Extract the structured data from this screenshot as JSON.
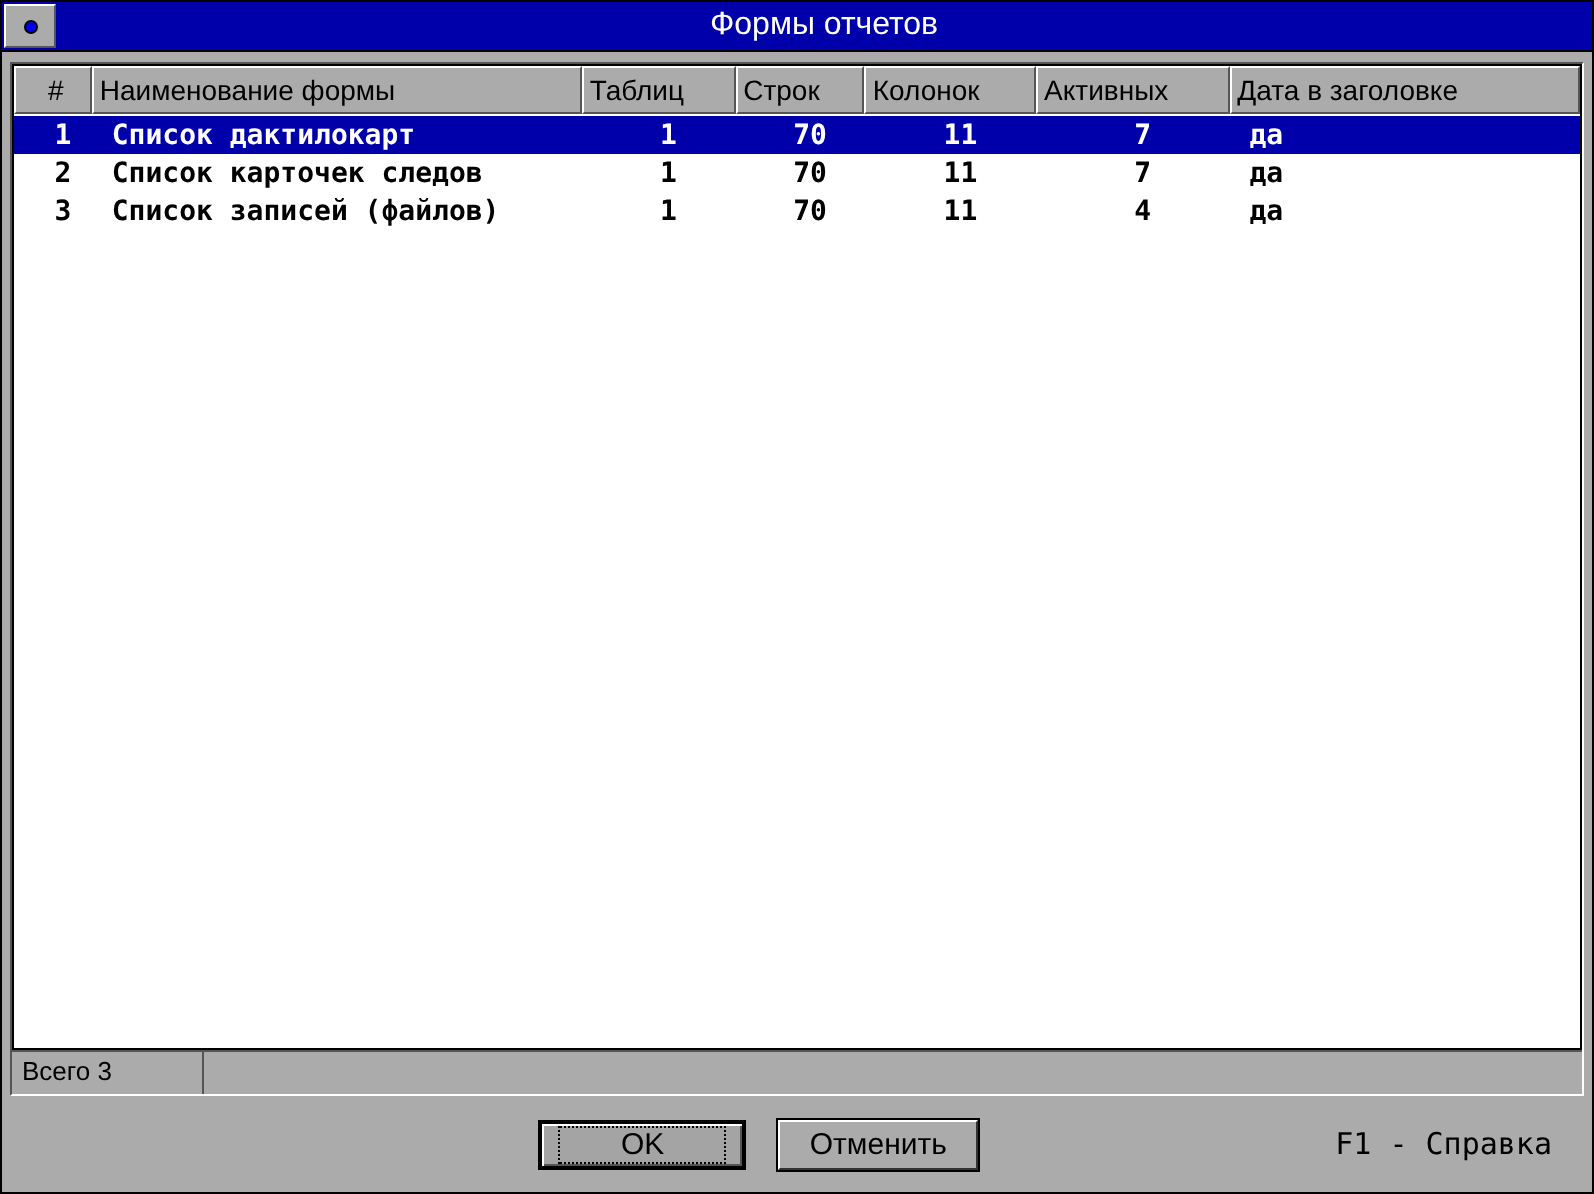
{
  "window": {
    "title": "Формы отчетов"
  },
  "table": {
    "columns": [
      "#",
      "Наименование формы",
      "Таблиц",
      "Строк",
      "Колонок",
      "Активных",
      "Дата в заголовке"
    ],
    "rows": [
      {
        "cells": [
          "1",
          "Список дактилокарт",
          "1",
          "70",
          "11",
          "7",
          "да"
        ],
        "selected": true
      },
      {
        "cells": [
          "2",
          "Список карточек следов",
          "1",
          "70",
          "11",
          "7",
          "да"
        ],
        "selected": false
      },
      {
        "cells": [
          "3",
          "Список записей (файлов)",
          "1",
          "70",
          "11",
          "4",
          "да"
        ],
        "selected": false
      }
    ]
  },
  "status_bar": {
    "total": "Всего 3"
  },
  "buttons": [
    {
      "label": "OK",
      "focused": true
    },
    {
      "label": "Отменить",
      "focused": false
    }
  ],
  "help_hint": "F1 - Справка"
}
